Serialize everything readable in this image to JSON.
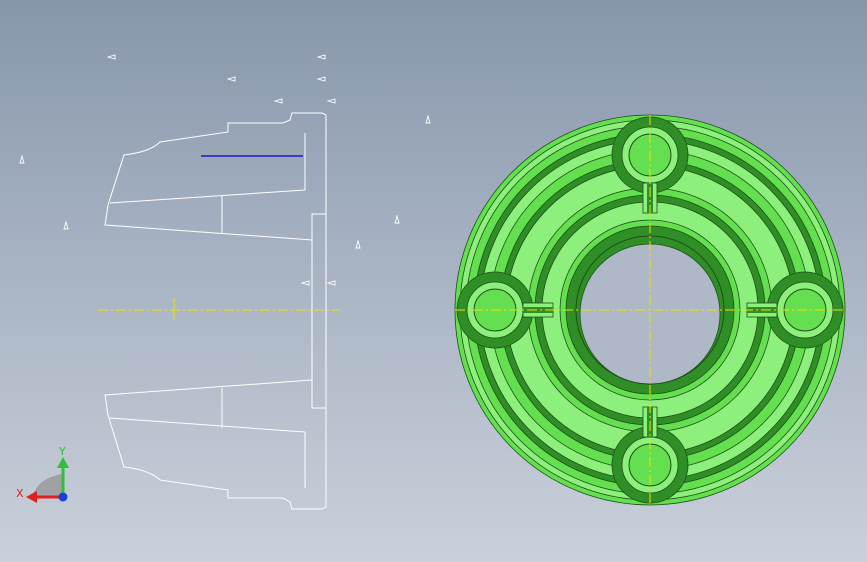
{
  "viewport": {
    "background_top": "#8796ab",
    "background_bottom": "#c9d0da"
  },
  "drawing": {
    "outline_color": "#ffffff",
    "centerline_color": "#f0e000",
    "highlight_line_color": "#0000cc"
  },
  "part": {
    "fill_color": "#63df4f",
    "fill_dark": "#2f8f26",
    "fill_light": "#8ef07c",
    "edge_color": "#1f4d18",
    "bolt_count": 4
  },
  "triad": {
    "x_label": "X",
    "y_label": "Y",
    "x_color": "#e0201e",
    "y_color": "#2fbf3c",
    "z_color": "#1c3fd6"
  }
}
